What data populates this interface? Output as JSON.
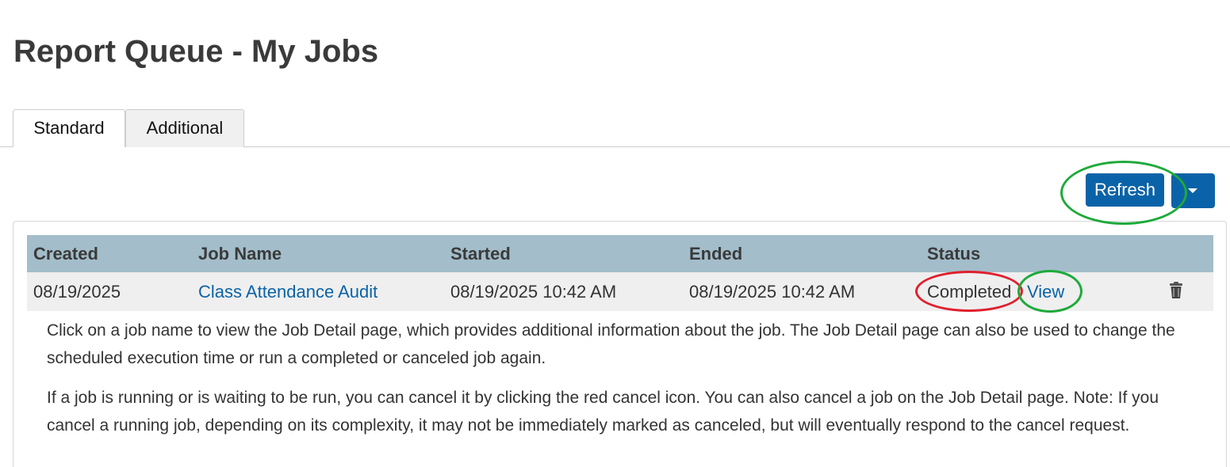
{
  "page": {
    "title": "Report Queue - My Jobs"
  },
  "tabs": [
    {
      "label": "Standard",
      "active": true
    },
    {
      "label": "Additional",
      "active": false
    }
  ],
  "toolbar": {
    "refresh_label": "Refresh",
    "dropdown_icon": "caret-down-icon",
    "accent_color": "#0a63a8"
  },
  "table": {
    "columns": [
      "Created",
      "Job Name",
      "Started",
      "Ended",
      "Status"
    ],
    "rows": [
      {
        "created": "08/19/2025",
        "job_name": "Class Attendance Audit",
        "started": "08/19/2025 10:42 AM",
        "ended": "08/19/2025 10:42 AM",
        "status": "Completed",
        "view_label": "View",
        "delete_icon": "trash-icon"
      }
    ],
    "header_color": "#a3bdca",
    "row_color": "#efefef"
  },
  "help": {
    "paragraph_1": "Click on a job name to view the Job Detail page, which provides additional information about the job. The Job Detail page can also be used to change the scheduled execution time or run a completed or canceled job again.",
    "paragraph_2": "If a job is running or is waiting to be run, you can cancel it by clicking the red cancel icon. You can also cancel a job on the Job Detail page. Note: If you cancel a running job, depending on its complexity, it may not be immediately marked as canceled, but will eventually respond to the cancel request."
  },
  "annotations": {
    "green_color": "#1faa3a",
    "red_color": "#e0202e"
  }
}
